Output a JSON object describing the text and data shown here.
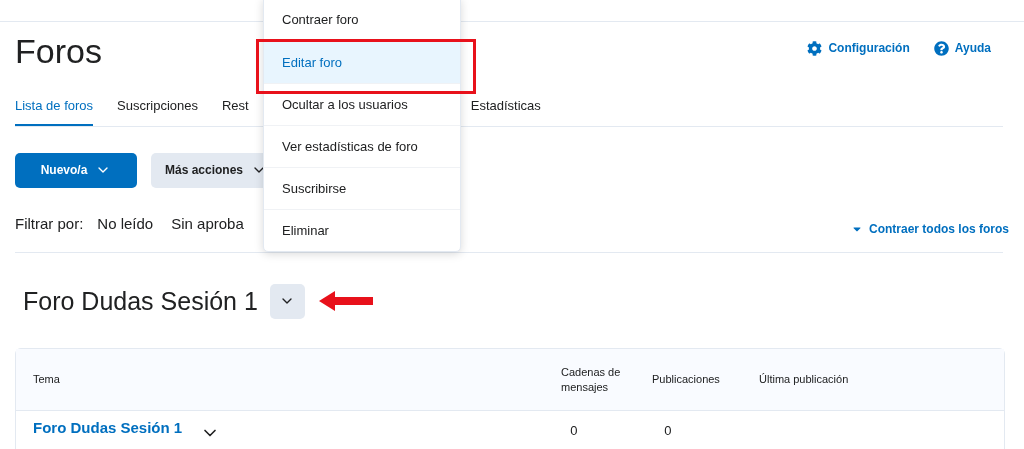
{
  "page": {
    "title": "Foros",
    "links": [
      {
        "kind": "settings",
        "label": "Configuración"
      },
      {
        "kind": "help",
        "label": "Ayuda"
      }
    ]
  },
  "tabs": [
    {
      "label": "Lista de foros",
      "selected": true
    },
    {
      "label": "Suscripciones",
      "selected": false
    },
    {
      "label": "Rest",
      "selected": false
    },
    {
      "label": "Estadísticas",
      "selected": false
    }
  ],
  "toolbar": {
    "primary": "Nuevo/a",
    "secondary": "Más acciones"
  },
  "filter": {
    "label": "Filtrar por:",
    "options": [
      "No leído",
      "Sin aproba"
    ],
    "collapse_all": "Contraer todos los foros"
  },
  "forum": {
    "title": "Foro Dudas Sesión 1"
  },
  "menu": [
    {
      "label": "Contraer foro",
      "selected": false
    },
    {
      "label": "Editar foro",
      "selected": true
    },
    {
      "label": "Ocultar a los usuarios",
      "selected": false
    },
    {
      "label": "Ver estadísticas de foro",
      "selected": false
    },
    {
      "label": "Suscribirse",
      "selected": false
    },
    {
      "label": "Eliminar",
      "selected": false
    }
  ],
  "table": {
    "columns": [
      "Tema",
      "Cadenas de mensajes",
      "Publicaciones",
      "Última publicación"
    ],
    "rows": [
      {
        "topic": "Foro Dudas Sesión 1",
        "threads": "0",
        "posts": "0"
      }
    ]
  }
}
